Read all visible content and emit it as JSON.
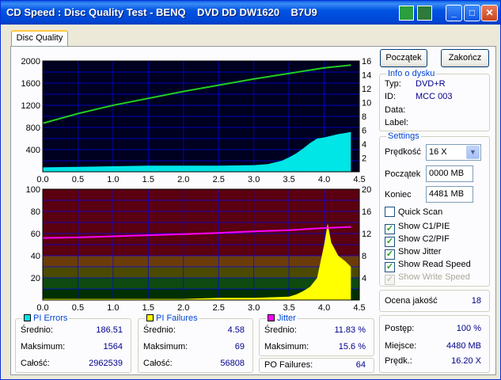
{
  "window": {
    "title": "CD Speed : Disc Quality Test - BENQ    DVD DD DW1620    B7U9",
    "buttons": {
      "minimize": "_",
      "maximize": "□",
      "close": "✕"
    }
  },
  "tabs": [
    {
      "label": "Disc Quality",
      "active": true
    }
  ],
  "buttons": {
    "start": "Początek",
    "end": "Zakończ"
  },
  "disc_info": {
    "title": "Info o dysku",
    "type_label": "Typ:",
    "type_value": "DVD+R",
    "id_label": "ID:",
    "id_value": "MCC 003",
    "date_label": "Data:",
    "date_value": "",
    "label_label": "Label:",
    "label_value": ""
  },
  "settings": {
    "title": "Settings",
    "speed_label": "Prędkość",
    "speed_value": "16 X",
    "start_label": "Początek",
    "start_value": "0000 MB",
    "end_label": "Koniec",
    "end_value": "4481 MB",
    "checks": [
      {
        "label": "Quick Scan",
        "checked": false,
        "disabled": false
      },
      {
        "label": "Show C1/PIE",
        "checked": true,
        "disabled": false
      },
      {
        "label": "Show C2/PIF",
        "checked": true,
        "disabled": false
      },
      {
        "label": "Show Jitter",
        "checked": true,
        "disabled": false
      },
      {
        "label": "Show Read Speed",
        "checked": true,
        "disabled": false
      },
      {
        "label": "Show Write Speed",
        "checked": true,
        "disabled": true
      }
    ]
  },
  "quality": {
    "label": "Ocena jakość",
    "value": "18"
  },
  "progress": {
    "progress_label": "Postęp:",
    "progress_value": "100 %",
    "position_label": "Miejsce:",
    "position_value": "4480 MB",
    "speed_label": "Prędk.:",
    "speed_value": "16.20 X"
  },
  "pi_errors": {
    "title": "PI Errors",
    "color": "#00e5e5",
    "avg_label": "Średnio:",
    "avg": "186.51",
    "max_label": "Maksimum:",
    "max": "1564",
    "total_label": "Całość:",
    "total": "2962539"
  },
  "pi_failures": {
    "title": "PI Failures",
    "color": "#ffff00",
    "avg_label": "Średnio:",
    "avg": "4.58",
    "max_label": "Maksimum:",
    "max": "69",
    "total_label": "Całość:",
    "total": "56808"
  },
  "jitter": {
    "title": "Jitter",
    "color": "#ff00ff",
    "avg_label": "Średnio:",
    "avg": "11.83 %",
    "max_label": "Maksimum:",
    "max": "15.6 %"
  },
  "po_failures": {
    "label": "PO Failures:",
    "value": "64"
  },
  "colors": {
    "speed_line": "#22cc22",
    "pie": "#00e5e5",
    "pif": "#ffff00",
    "jitter": "#ff00ff",
    "grid": "#0000ff"
  },
  "chart_data": [
    {
      "type": "area",
      "name_ref": "pi_errors_chart",
      "x_ticks": [
        "0.0",
        "0.5",
        "1.0",
        "1.5",
        "2.0",
        "2.5",
        "3.0",
        "3.5",
        "4.0",
        "4.5"
      ],
      "y_left_ticks": [
        "2000",
        "1600",
        "1200",
        "800",
        "400"
      ],
      "y_right_ticks": [
        "16",
        "14",
        "12",
        "10",
        "8",
        "6",
        "4",
        "2"
      ],
      "xlim": [
        0,
        4.5
      ],
      "ylim_left": [
        0,
        2000
      ],
      "ylim_right": [
        0,
        16
      ],
      "grid": true,
      "series": [
        {
          "kind": "area",
          "axis": "left",
          "x": [
            0,
            0.5,
            1.0,
            1.5,
            2.0,
            2.5,
            3.0,
            3.2,
            3.4,
            3.5,
            3.6,
            3.7,
            3.8,
            3.9,
            4.0,
            4.1,
            4.2,
            4.3,
            4.38
          ],
          "values": [
            80,
            90,
            100,
            110,
            110,
            110,
            120,
            140,
            200,
            260,
            330,
            420,
            520,
            600,
            620,
            650,
            680,
            700,
            720
          ]
        },
        {
          "kind": "line",
          "axis": "right",
          "x": [
            0,
            0.5,
            1.0,
            1.5,
            2.0,
            2.5,
            3.0,
            3.5,
            4.0,
            4.38
          ],
          "values": [
            7.0,
            8.4,
            9.6,
            10.6,
            11.6,
            12.5,
            13.4,
            14.2,
            15.0,
            15.4
          ]
        }
      ]
    },
    {
      "type": "area",
      "name_ref": "pi_failures_chart",
      "x_ticks": [
        "0.0",
        "0.5",
        "1.0",
        "1.5",
        "2.0",
        "2.5",
        "3.0",
        "3.5",
        "4.0",
        "4.5"
      ],
      "y_left_ticks": [
        "100",
        "80",
        "60",
        "40",
        "20"
      ],
      "y_right_ticks": [
        "20",
        "16",
        "12",
        "8",
        "4"
      ],
      "xlim": [
        0,
        4.5
      ],
      "ylim_left": [
        0,
        100
      ],
      "ylim_right": [
        0,
        20
      ],
      "grid": true,
      "series": [
        {
          "kind": "area",
          "axis": "left",
          "x": [
            0,
            0.5,
            1.0,
            1.5,
            2.0,
            2.5,
            3.0,
            3.5,
            3.6,
            3.7,
            3.8,
            3.9,
            4.0,
            4.05,
            4.1,
            4.2,
            4.3,
            4.38
          ],
          "values": [
            1,
            1,
            1,
            1,
            1,
            2,
            2,
            3,
            5,
            8,
            12,
            20,
            50,
            69,
            52,
            40,
            35,
            30
          ]
        },
        {
          "kind": "line",
          "axis": "right",
          "x": [
            0,
            0.5,
            1.0,
            1.5,
            2.0,
            2.5,
            3.0,
            3.5,
            4.0,
            4.38
          ],
          "values": [
            11.2,
            11.3,
            11.5,
            11.7,
            11.9,
            12.1,
            12.4,
            12.6,
            13.0,
            13.2
          ]
        }
      ]
    }
  ]
}
